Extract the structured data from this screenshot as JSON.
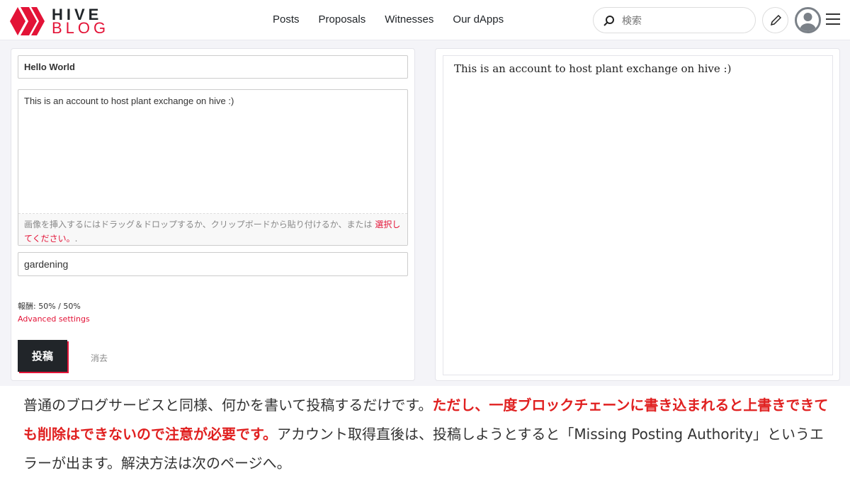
{
  "header": {
    "logo": {
      "line1": "HIVE",
      "line2": "BLOG"
    },
    "nav": [
      "Posts",
      "Proposals",
      "Witnesses",
      "Our dApps"
    ],
    "search_placeholder": "検索"
  },
  "editor": {
    "title": "Hello World",
    "body": "This is an account to host plant exchange on hive :)",
    "hint": "画像を挿入するにはドラッグ＆ドロップするか、クリップボードから貼り付けるか、または ",
    "hint_link": "選択してください。",
    "hint_end": ".",
    "tags": "gardening",
    "reward": "報酬: 50% / 50%",
    "advanced": "Advanced settings",
    "submit": "投稿",
    "clear": "消去"
  },
  "preview": {
    "text": "This is an account to host plant exchange on hive :)"
  },
  "caption": {
    "part1": "普通のブログサービスと同様、何かを書いて投稿するだけです。",
    "highlight": "ただし、一度ブロックチェーンに書き込まれると上書きできても削除はできないので注意が必要です。",
    "part2": "アカウント取得直後は、投稿しようとすると「Missing Posting Authority」というエラーが出ます。解決方法は次のページへ。"
  },
  "colors": {
    "brand": "#e31337",
    "button": "#212529",
    "highlight": "#e02020"
  }
}
